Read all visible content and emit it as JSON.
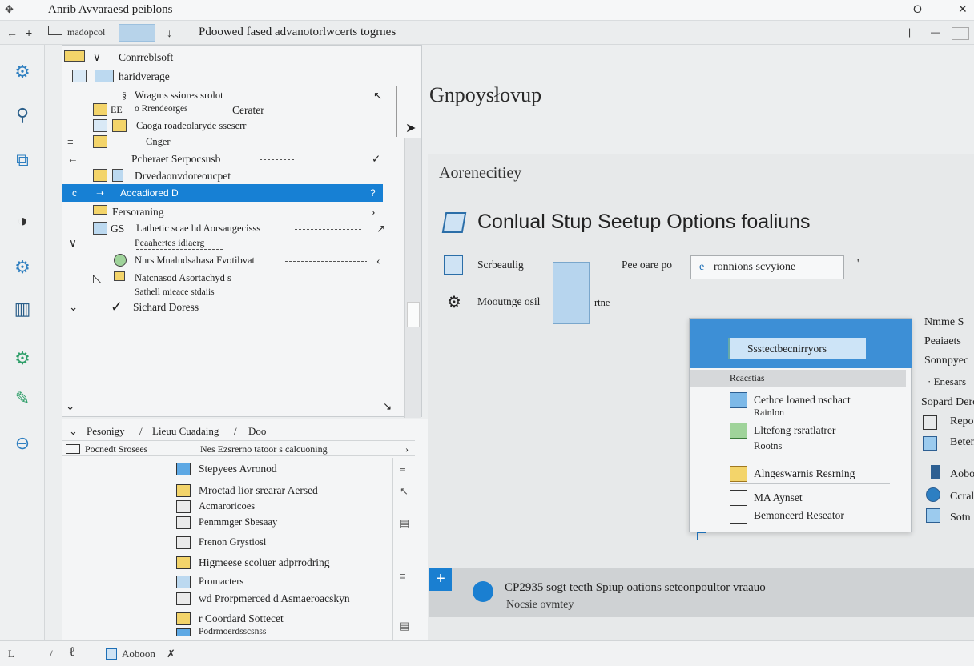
{
  "window": {
    "title": "Anrib Avvaraesd peiblons",
    "icon": "move-icon",
    "controls": [
      "—",
      "O",
      "✕"
    ]
  },
  "toolbar": {
    "back": "←",
    "forward": "+",
    "folder_label": "madopcol",
    "down": "↓",
    "address": "Pdoowed fased advanotorlwcerts togrnes",
    "divider": "|",
    "minimize": "—",
    "close": "✕"
  },
  "rail": {
    "icons": [
      "gear-icon",
      "magnifier-icon",
      "box-icon",
      "person-icon",
      "settings-icon",
      "book-icon",
      "gear-doc-icon",
      "pen-icon",
      "minus-circle-icon"
    ]
  },
  "tree": {
    "rows": [
      "Conrreblsoft",
      "haridverage",
      "Wragms ssiores srolot",
      "Cerater",
      "o Rrendeorges",
      "Caoga roadeolaryde sseserr",
      "Cnger",
      "Pcheraet Serpocsusb",
      "Drvedaonvdoreoucpet",
      "Aocadiored D",
      "Fersoraning",
      "Lathetic scae hd Aorsaugecisss",
      "Peaahertes idiaerg",
      "Nnrs Mnalndsahasa Fvotibvat",
      "Natcnasod Asortachyd s",
      "Sathell mieace stdaiis",
      "Sichard Doress"
    ],
    "selected": "Aocadiored D",
    "selected_suffix": "?",
    "gs_label": "GS",
    "ee_label": "EE"
  },
  "bottom_pane": {
    "tabs": [
      "Pesonigy",
      "Lieuu Cuadaing",
      "Doo"
    ],
    "crumb_left": "Pocnedt Srosees",
    "crumb_right": "Nes Ezsrerno tatoor s calcuoning",
    "items": [
      "Stepyees Avronod",
      "Mroctad lior srearar Aersed",
      "Acmaroricoes",
      "Penmmger Sbesaay",
      "Frenon Grystiosl",
      "Higmeese scoluer adprrodring",
      "Promacters",
      "wd Prorpmerced d Asmaeroacskyn",
      "r Coordard Sottecet",
      "Podrmoerdsscsnss"
    ],
    "scroll_icons": [
      "≡",
      "↖",
      "▤",
      "≡",
      "▤"
    ]
  },
  "main": {
    "heading": "Gnpoysłovup",
    "card_subtitle": "Aorenecitiey",
    "card_title": "Conlual Stup Seetup Options foaliuns",
    "opt1": "Scrbeaulig",
    "opt2": "Mooutnge osil",
    "opt2_suffix": "rtne",
    "pre_label": "Pee oare po",
    "input_value": "ronnions scvyione",
    "input_icon": "e",
    "apostrophe": "'"
  },
  "popup": {
    "top_item": "Ssstectbecnirryors",
    "header": "Rcacstias",
    "items": [
      "Cethce loaned nschact",
      "Rainlon",
      "Lltefong rsratlatrer",
      "Rootns",
      "Alngeswarnis Resrning",
      "MA Aynset",
      "Bemoncerd Reseator"
    ]
  },
  "side_list": {
    "items": [
      "Nmme S",
      "Peaiaets",
      "Sonnpyec",
      "· Enesars",
      "Sopard Dero",
      "Repo",
      "Beten",
      "Aobo",
      "Ccralo",
      "Sotn"
    ]
  },
  "banner": {
    "line1": "CP2935 sogt tecth Spiup oations seteonpoultor vraauo",
    "line2": "Nocsie ovmtey",
    "plus": "+"
  },
  "statusbar": {
    "items": [
      "L",
      "/",
      "ℓ",
      "Aoboon",
      "✗"
    ]
  },
  "colors": {
    "accent": "#1780d4",
    "banner_bg": "#cfd2d4",
    "popup_header": "#3d8fd6"
  }
}
